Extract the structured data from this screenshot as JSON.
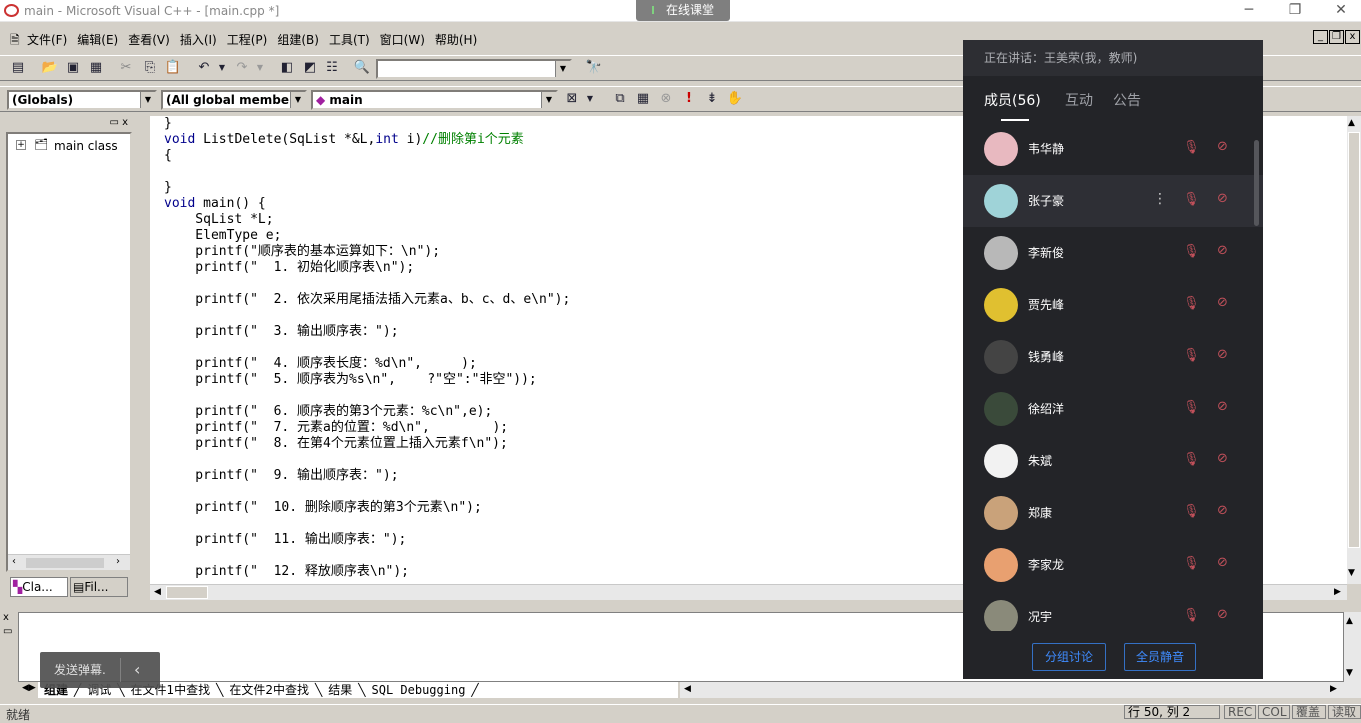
{
  "window": {
    "title": "main - Microsoft Visual C++ - [main.cpp *]"
  },
  "classroom": {
    "label": "在线课堂"
  },
  "menubar": {
    "items": [
      "文件(F)",
      "编辑(E)",
      "查看(V)",
      "插入(I)",
      "工程(P)",
      "组建(B)",
      "工具(T)",
      "窗口(W)",
      "帮助(H)"
    ]
  },
  "wizardbar": {
    "scope": "(Globals)",
    "members": "(All global members",
    "function": "main"
  },
  "classview": {
    "tree_item": "main class",
    "tab_class": "Cla...",
    "tab_file": "Fil..."
  },
  "code": {
    "lines": [
      "}",
      "void ListDelete(SqList *&L,int i)//删除第i个元素",
      "{",
      "",
      "}",
      "void main() {",
      "    SqList *L;",
      "    ElemType e;",
      "    printf(\"顺序表的基本运算如下：\\n\");",
      "    printf(\"  1. 初始化顺序表\\n\");",
      "",
      "    printf(\"  2. 依次采用尾插法插入元素a、b、c、d、e\\n\");",
      "",
      "    printf(\"  3. 输出顺序表：\");",
      "",
      "    printf(\"  4. 顺序表长度：%d\\n\",     );",
      "    printf(\"  5. 顺序表为%s\\n\",    ?\"空\":\"非空\"));",
      "",
      "    printf(\"  6. 顺序表的第3个元素：%c\\n\",e);",
      "    printf(\"  7. 元素a的位置：%d\\n\",        );",
      "    printf(\"  8. 在第4个元素位置上插入元素f\\n\");",
      "",
      "    printf(\"  9. 输出顺序表：\");",
      "",
      "    printf(\"  10. 删除顺序表的第3个元素\\n\");",
      "",
      "    printf(\"  11. 输出顺序表：\");",
      "",
      "    printf(\"  12. 释放顺序表\\n\");"
    ]
  },
  "output_tabs": [
    "组建",
    "调试",
    "在文件1中查找",
    "在文件2中查找",
    "结果",
    "SQL Debugging"
  ],
  "danmu": {
    "label": "发送弹幕."
  },
  "statusbar": {
    "ready": "就绪",
    "position": "行 50, 列 2",
    "rec": "REC",
    "col": "COL",
    "ovr": "覆盖",
    "read": "读取"
  },
  "panel": {
    "speaking": "正在讲话：王美荣(我，教师)",
    "tabs": [
      "成员(56)",
      "互动",
      "公告"
    ],
    "members": [
      "韦华静",
      "张子豪",
      "李新俊",
      "贾先峰",
      "钱勇峰",
      "徐绍洋",
      "朱斌",
      "郑康",
      "李家龙",
      "况宇"
    ],
    "avatar_colors": [
      "#e8b9c0",
      "#9fd3d8",
      "#b8b8b8",
      "#e0c030",
      "#444444",
      "#3a4a3a",
      "#f2f2f2",
      "#c9a27a",
      "#e8a070",
      "#8a8a7a"
    ],
    "group_button": "分组讨论",
    "mute_button": "全员静音"
  }
}
